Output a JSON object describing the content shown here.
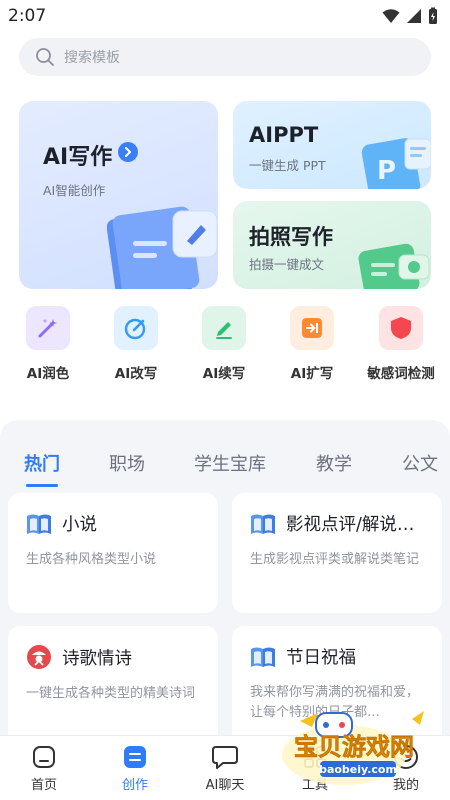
{
  "status_bar": {
    "time": "2:07"
  },
  "search": {
    "placeholder": "搜索模板"
  },
  "feature_cards": {
    "ai_write": {
      "title": "AI写作",
      "subtitle": "AI智能创作"
    },
    "ai_ppt": {
      "title": "AIPPT",
      "subtitle": "一键生成 PPT"
    },
    "photo_write": {
      "title": "拍照写作",
      "subtitle": "拍摄一键成文"
    }
  },
  "tools": [
    {
      "label": "AI润色",
      "icon": "magic-wand-icon",
      "color": "#8f6cf7"
    },
    {
      "label": "AI改写",
      "icon": "edit-circle-icon",
      "color": "#2f9bf6"
    },
    {
      "label": "AI续写",
      "icon": "pen-icon",
      "color": "#2fbf71"
    },
    {
      "label": "AI扩写",
      "icon": "expand-icon",
      "color": "#ff8a34"
    },
    {
      "label": "敏感词检测",
      "icon": "shield-icon",
      "color": "#f5474f"
    }
  ],
  "tabs": [
    "热门",
    "职场",
    "学生宝库",
    "教学",
    "公文"
  ],
  "template_cards": [
    {
      "title": "小说",
      "desc": "生成各种风格类型小说",
      "icon": "book-icon"
    },
    {
      "title": "影视点评/解说…",
      "desc": "生成影视点评类或解说类笔记",
      "icon": "book-icon"
    },
    {
      "title": "诗歌情诗",
      "desc": "一键生成各种类型的精美诗词",
      "icon": "poem-badge-icon"
    },
    {
      "title": "节日祝福",
      "desc": "我来帮你写满满的祝福和爱，让每个特别的日子都…",
      "icon": "book-icon"
    }
  ],
  "bottom_nav": [
    {
      "label": "首页",
      "icon": "home-icon"
    },
    {
      "label": "创作",
      "icon": "create-icon"
    },
    {
      "label": "AI聊天",
      "icon": "chat-icon"
    },
    {
      "label": "工具",
      "icon": "tool-icon"
    },
    {
      "label": "我的",
      "icon": "profile-icon"
    }
  ],
  "watermark": {
    "text": "宝贝游戏网",
    "url_text": "baobeiy.com"
  },
  "colors": {
    "accent": "#2f7cf6",
    "panel_bg": "#f4f5f8"
  }
}
